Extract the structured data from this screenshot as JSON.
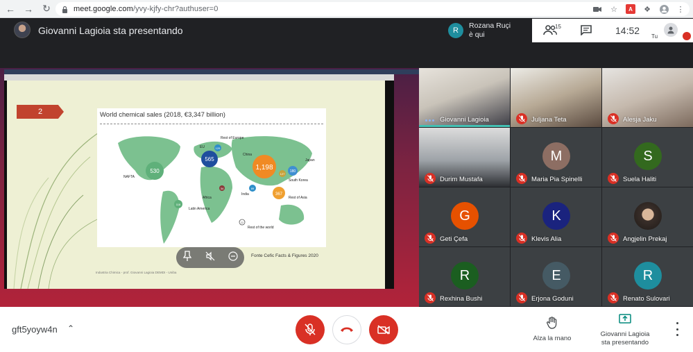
{
  "browser": {
    "url_host": "meet.google.com",
    "url_path": "/yvy-kjfy-chr?authuser=0"
  },
  "header": {
    "presenting_title": "Giovanni Lagioia sta presentando",
    "notification": {
      "initial": "R",
      "line1": "Rozana Ruçi",
      "line2": "è qui"
    },
    "people_count": "15",
    "time": "14:52",
    "self_label": "Tu"
  },
  "slide": {
    "number": "2",
    "chart_title": "World chemical sales (2018, €3,347 billion)",
    "regions": [
      {
        "label": "NAFTA",
        "value": "530"
      },
      {
        "label": "EU",
        "value": "565"
      },
      {
        "label": "Rest of Europe",
        "value": "129"
      },
      {
        "label": "China",
        "value": "1,198"
      },
      {
        "label": "Japan",
        "value": ""
      },
      {
        "label": "South Korea",
        "value": "180"
      },
      {
        "label": "",
        "value": "127"
      },
      {
        "label": "Rest of Asia",
        "value": "367"
      },
      {
        "label": "India",
        "value": "89"
      },
      {
        "label": "Africa",
        "value": "34"
      },
      {
        "label": "Latin America",
        "value": "118"
      },
      {
        "label": "Rest of the world",
        "value": "22"
      }
    ],
    "source": "Fonte Cefic Facts & Figures 2020",
    "footer": "Industria Chimica - prof. Giovanni Lagioia DEMDI - Uniba"
  },
  "participants": [
    {
      "name": "Giovanni Lagioia",
      "type": "video",
      "muted": false,
      "speaking": true
    },
    {
      "name": "Juljana Teta",
      "type": "video",
      "muted": true
    },
    {
      "name": "Alesja Jaku",
      "type": "video",
      "muted": true
    },
    {
      "name": "Durim Mustafa",
      "type": "video",
      "muted": true
    },
    {
      "name": "Maria Pia Spinelli",
      "type": "avatar",
      "initial": "M",
      "color": "#8d6e63",
      "muted": true
    },
    {
      "name": "Suela Haliti",
      "type": "avatar",
      "initial": "S",
      "color": "#33691e",
      "muted": true
    },
    {
      "name": "Geti Çefa",
      "type": "avatar",
      "initial": "G",
      "color": "#e65100",
      "muted": true
    },
    {
      "name": "Klevis Alia",
      "type": "avatar",
      "initial": "K",
      "color": "#1a237e",
      "muted": true
    },
    {
      "name": "Angjelin Prekaj",
      "type": "photo",
      "muted": true
    },
    {
      "name": "Rexhina Bushi",
      "type": "avatar",
      "initial": "R",
      "color": "#1b5e20",
      "muted": true
    },
    {
      "name": "Erjona Goduni",
      "type": "avatar",
      "initial": "E",
      "color": "#455a64",
      "muted": true
    },
    {
      "name": "Renato Sulovari",
      "type": "avatar",
      "initial": "R",
      "color": "#1e8e9e",
      "muted": true
    }
  ],
  "bottombar": {
    "meeting_code": "gft5yoyw4n",
    "raise_hand_label": "Alza la mano",
    "presenting_label_line1": "Giovanni Lagioia",
    "presenting_label_line2": "sta presentando"
  },
  "colors": {
    "danger": "#d93025",
    "accent_teal": "#44c1b4",
    "dark_bg": "#202124"
  }
}
